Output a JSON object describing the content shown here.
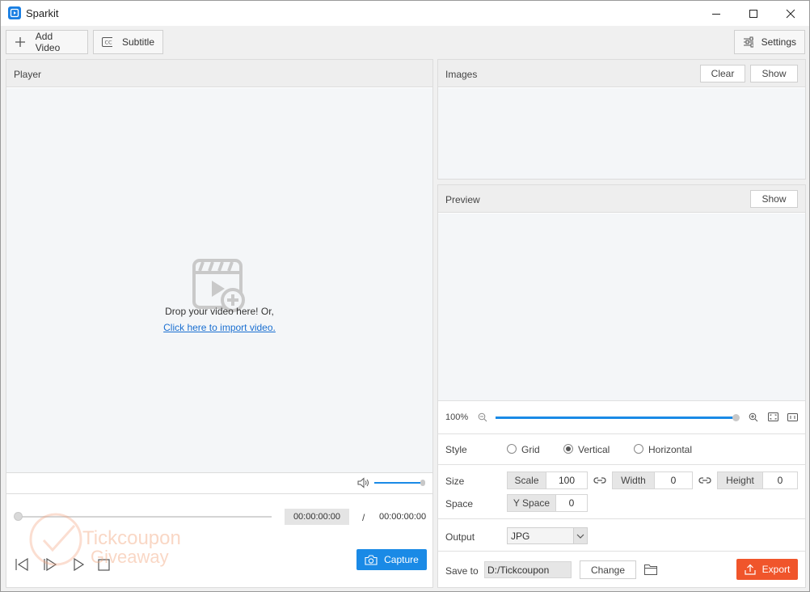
{
  "window": {
    "title": "Sparkit"
  },
  "toolbar": {
    "add_video_label": "Add Video",
    "subtitle_label": "Subtitle",
    "settings_label": "Settings"
  },
  "player": {
    "title": "Player",
    "drop_text": "Drop your video here! Or,",
    "import_link": "Click here to import video.",
    "volume_level": 1.0,
    "progress": 0.0,
    "current_time": "00:00:00:00",
    "separator": "/",
    "total_time": "00:00:00:00",
    "capture_label": "Capture"
  },
  "images": {
    "title": "Images",
    "clear_label": "Clear",
    "show_label": "Show"
  },
  "preview": {
    "title": "Preview",
    "show_label": "Show",
    "zoom_text": "100%",
    "zoom_level": 1.0
  },
  "style": {
    "label": "Style",
    "options": [
      "Grid",
      "Vertical",
      "Horizontal"
    ],
    "selected": "Vertical"
  },
  "size": {
    "label": "Size",
    "scale_label": "Scale",
    "scale_value": "100",
    "width_label": "Width",
    "width_value": "0",
    "height_label": "Height",
    "height_value": "0"
  },
  "space": {
    "label": "Space",
    "yspace_label": "Y Space",
    "yspace_value": "0"
  },
  "output": {
    "label": "Output",
    "format": "JPG"
  },
  "save": {
    "label": "Save to",
    "path": "D:/Tickcoupon",
    "change_label": "Change",
    "export_label": "Export"
  },
  "watermark": {
    "line1": "Tickcoupon",
    "line2": "Giveaway"
  },
  "colors": {
    "accent": "#1a8ae6",
    "export": "#f0552b",
    "link": "#1a6fd1"
  }
}
